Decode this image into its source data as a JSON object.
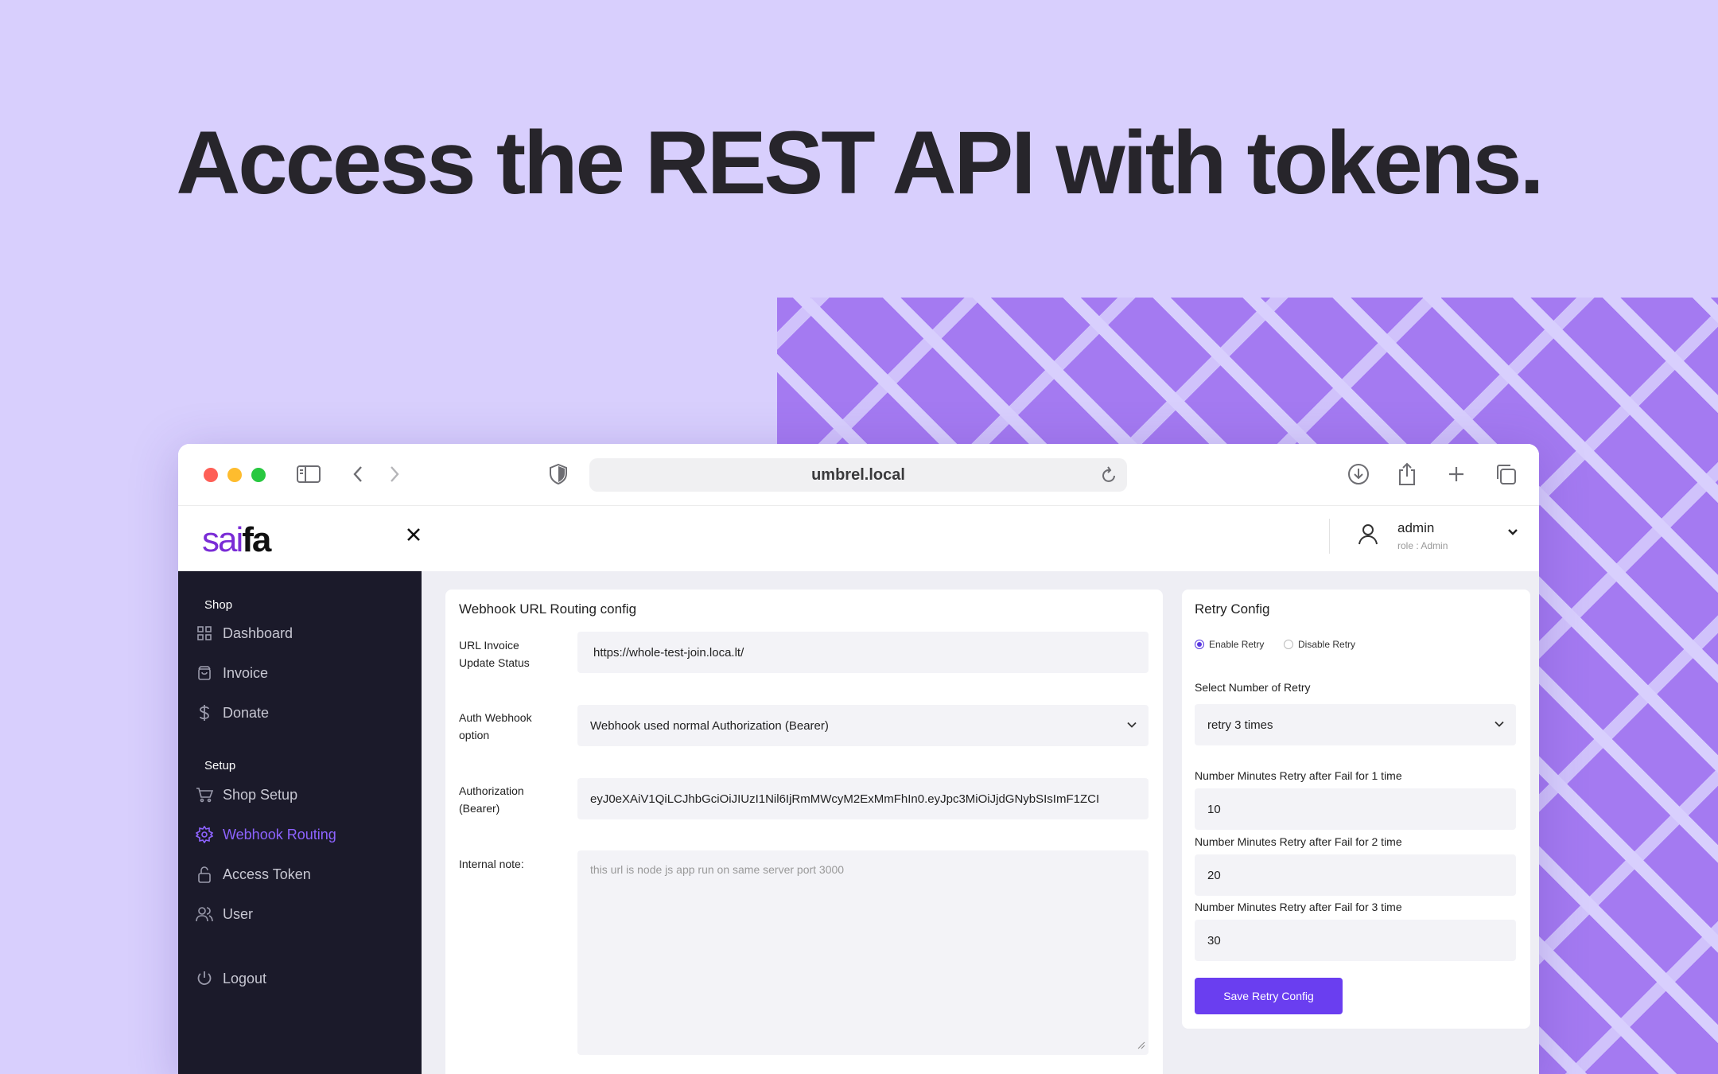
{
  "headline": "Access the REST API with tokens.",
  "colors": {
    "accent": "#6a3ef0",
    "sidebar_bg": "#1b1a2a",
    "active_nav": "#8d63ff",
    "page_bg": "#d8cffd",
    "pattern": "#a47af1"
  },
  "browser": {
    "url": "umbrel.local"
  },
  "app": {
    "logo_part1": "sai",
    "logo_part2": "fa",
    "user": {
      "name": "admin",
      "role": "role : Admin"
    }
  },
  "sidebar": {
    "section_shop": "Shop",
    "section_setup": "Setup",
    "items": [
      {
        "label": "Dashboard",
        "icon": "grid-icon"
      },
      {
        "label": "Invoice",
        "icon": "bag-icon"
      },
      {
        "label": "Donate",
        "icon": "dollar-icon"
      },
      {
        "label": "Shop Setup",
        "icon": "cart-icon"
      },
      {
        "label": "Webhook Routing",
        "icon": "gear-icon",
        "active": true
      },
      {
        "label": "Access Token",
        "icon": "lock-icon"
      },
      {
        "label": "User",
        "icon": "users-icon"
      },
      {
        "label": "Logout",
        "icon": "power-icon"
      }
    ]
  },
  "webhook": {
    "title": "Webhook URL Routing config",
    "url_label": "URL Invoice Update Status",
    "url_value": "https://whole-test-join.loca.lt/",
    "auth_label": "Auth Webhook option",
    "auth_value": "Webhook used normal Authorization (Bearer)",
    "token_label": "Authorization (Bearer)",
    "token_value": "eyJ0eXAiV1QiLCJhbGciOiJIUzI1Nil6IjRmMWcyM2ExMmFhIn0.eyJpc3MiOiJjdGNybSIsImF1ZCI",
    "note_label": "Internal note:",
    "note_placeholder": "this url is node js app run on same server port 3000"
  },
  "retry": {
    "title": "Retry Config",
    "enable_label": "Enable Retry",
    "disable_label": "Disable Retry",
    "count_label": "Select Number of Retry",
    "count_value": "retry 3 times",
    "retry1_label": "Number Minutes Retry after Fail for 1 time",
    "retry1_value": "10",
    "retry2_label": "Number Minutes Retry after Fail for 2 time",
    "retry2_value": "20",
    "retry3_label": "Number Minutes Retry after Fail for 3 time",
    "retry3_value": "30",
    "save_label": "Save Retry Config"
  }
}
